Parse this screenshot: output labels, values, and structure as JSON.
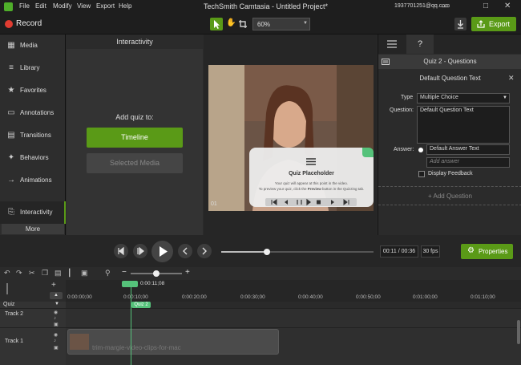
{
  "menu": {
    "file": "File",
    "edit": "Edit",
    "modify": "Modify",
    "view": "View",
    "export": "Export",
    "help": "Help"
  },
  "title": "TechSmith Camtasia - Untitled Project*",
  "account": "1937701251@qq.com",
  "toolbar": {
    "record": "Record",
    "zoom": "60%",
    "export_btn": "Export"
  },
  "sidebar": {
    "items": [
      {
        "label": "Media",
        "icon": "film-icon"
      },
      {
        "label": "Library",
        "icon": "library-icon"
      },
      {
        "label": "Favorites",
        "icon": "star-icon"
      },
      {
        "label": "Annotations",
        "icon": "annotation-icon"
      },
      {
        "label": "Transitions",
        "icon": "transition-icon"
      },
      {
        "label": "Behaviors",
        "icon": "behavior-icon"
      },
      {
        "label": "Animations",
        "icon": "animation-icon"
      },
      {
        "label": "Interactivity",
        "icon": "interactivity-icon"
      }
    ],
    "more": "More"
  },
  "interactivity": {
    "header": "Interactivity",
    "add_quiz": "Add quiz to:",
    "timeline_btn": "Timeline",
    "selected_media_btn": "Selected Media"
  },
  "preview": {
    "quiz_title": "Quiz Placeholder",
    "quiz_line1": "Your quiz will appear at this point in the video.",
    "quiz_line2_a": "To preview your quiz, click the",
    "quiz_line2_b": "Preview",
    "quiz_line2_c": "button in the Quizzing tab.",
    "frame_number": "01"
  },
  "properties": {
    "quiz_header": "Quiz 2 - Questions",
    "question_header": "Default Question Text",
    "type_label": "Type",
    "type_value": "Multiple Choice",
    "question_label": "Question:",
    "question_value": "Default Question Text",
    "answer_label": "Answer:",
    "answer_value": "Default Answer Text",
    "add_answer_placeholder": "Add answer",
    "display_feedback": "Display Feedback",
    "add_question": "+ Add Question"
  },
  "player": {
    "time_current": "00:11",
    "time_total": "00:36",
    "time_sep": " / ",
    "fps": "30 fps",
    "properties_btn": "Properties",
    "scrub_progress": 0.3
  },
  "timeline": {
    "playhead_time": "0:00:11;08",
    "ruler": [
      "0:00:00;00",
      "0:00:10;00",
      "0:00:20;00",
      "0:00:30;00",
      "0:00:40;00",
      "0:00:50;00",
      "0:01:00;00",
      "0:01:10;00"
    ],
    "quiz_track": "Quiz",
    "quiz_marker": "Quiz 2",
    "track2": "Track 2",
    "track1": "Track 1",
    "clip_label": "trim-margie-video-clips-for-mac"
  },
  "colors": {
    "accent_green": "#5a9a17",
    "playhead_green": "#55c27a"
  }
}
